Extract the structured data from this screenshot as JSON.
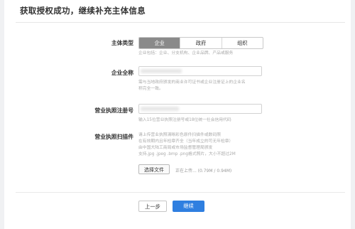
{
  "header": {
    "title": "获取授权成功，继续补充主体信息"
  },
  "subject_type": {
    "label": "主体类型",
    "options": [
      "企业",
      "政府",
      "组织"
    ],
    "selected": "企业",
    "hint": "企业包括：企业、分支机构、企业品牌、产品或服务"
  },
  "company_name": {
    "label": "企业全称",
    "hint_line1": "需与当地政府颁发的商业许可证书或企业注册证上的企业名",
    "hint_line2": "称完全一致。"
  },
  "license_number": {
    "label": "营业执照注册号",
    "hint": "输入15位营业执照注册号或18位统一社会信用代码"
  },
  "license_scan": {
    "label": "营业执照扫描件",
    "hints": [
      "请上传营业执照清晰彩色原件扫描件或数码照",
      "在有效期内且年检章齐全（当年成立的可无年检章）",
      "由中国大陆工商局或市场监督管理局颁发",
      "支持.jpg .jpeg .bmp .png格式照片，大小不超过2M"
    ],
    "button_label": "选择文件",
    "upload_status": "正在上传... (0.79M / 0.94M)"
  },
  "footer": {
    "prev_label": "上一步",
    "next_label": "继续"
  },
  "colors": {
    "primary": "#2f7fe0",
    "segment_active": "#8a8a8a"
  }
}
